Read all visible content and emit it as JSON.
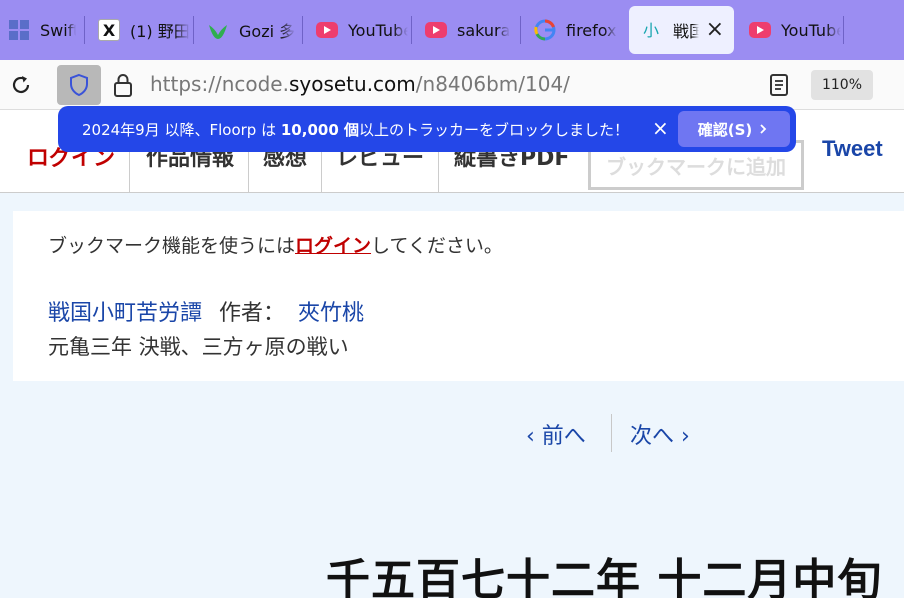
{
  "browser": {
    "tabs": [
      {
        "label": "SwiftD",
        "icon": "windows-grid-icon"
      },
      {
        "label": "(1) 野田",
        "icon": "x-logo-icon"
      },
      {
        "label": "Gozi 多",
        "icon": "leaf-icon"
      },
      {
        "label": "YouTube",
        "icon": "youtube-icon"
      },
      {
        "label": "sakura",
        "icon": "youtube-icon"
      },
      {
        "label": "firefox",
        "icon": "google-icon"
      },
      {
        "label": "戦国",
        "icon": "syosetu-icon",
        "active": true
      },
      {
        "label": "YouTube",
        "icon": "youtube-icon"
      }
    ],
    "url_prefix": "https://ncode.",
    "url_host": "syosetu.com",
    "url_path": "/n8406bm/104/",
    "zoom": "110%"
  },
  "notification": {
    "text_prefix": "2024年9月 以降、Floorp は ",
    "count": "10,000 個",
    "text_suffix": "以上のトラッカーをブロックしました！",
    "close": "×",
    "confirm_button": "確認(S)"
  },
  "site_nav": {
    "login": "ログイン",
    "info": "作品情報",
    "impression": "感想",
    "review": "レビュー",
    "pdf": "縦書きPDF",
    "bookmark": "ブックマークに追加",
    "tweet": "Tweet"
  },
  "content": {
    "bookmark_prefix": "ブックマーク機能を使うには",
    "bookmark_login": "ログイン",
    "bookmark_suffix": "してください。",
    "novel_title": "戦国小町苦労譚",
    "author_label": "作者：",
    "author": "夾竹桃",
    "subtitle": "元亀三年 決戦、三方ヶ原の戦い"
  },
  "pager": {
    "prev": "前へ",
    "next": "次へ"
  },
  "chapter_title": "千五百七十二年 十二月中旬"
}
